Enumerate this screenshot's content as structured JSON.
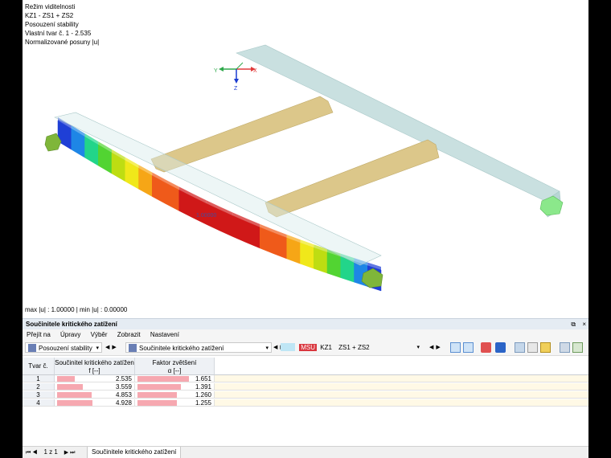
{
  "viewport": {
    "info_lines": [
      "Režim viditelnosti",
      "KZ1 - ZS1 + ZS2",
      "Posouzení stability",
      "Vlastní tvar č. 1 - 2.535",
      "Normalizované posuny |u|"
    ],
    "status": "max |u| : 1.00000 | min |u| : 0.00000",
    "label_value": "1.00000",
    "axes": {
      "x": "X",
      "y": "Y",
      "z": "Z"
    }
  },
  "panel": {
    "title": "Součinitele kritického zatížení",
    "window_buttons": {
      "float": "⧉",
      "close": "×"
    },
    "menu": [
      "Přejít na",
      "Úpravy",
      "Výběr",
      "Zobrazit",
      "Nastavení"
    ],
    "toolbar": {
      "module_combo": "Posouzení stability",
      "table_combo": "Součinitele kritického zatížení",
      "badge": "MSU",
      "combo_id": "KZ1",
      "combo_value": "ZS1 + ZS2"
    },
    "table": {
      "headers": {
        "col0": "Tvar č.",
        "col1_line1": "Součinitel kritického zatížen",
        "col1_line2": "f [--]",
        "col2_line1": "Faktor zvětšení",
        "col2_line2": "α [--]"
      },
      "rows": [
        {
          "num": "1",
          "f": "2.535",
          "f_frac": 0.51,
          "a": "1.651",
          "a_frac": 1.0
        },
        {
          "num": "2",
          "f": "3.559",
          "f_frac": 0.72,
          "a": "1.391",
          "a_frac": 0.84
        },
        {
          "num": "3",
          "f": "4.853",
          "f_frac": 0.98,
          "a": "1.260",
          "a_frac": 0.76
        },
        {
          "num": "4",
          "f": "4.928",
          "f_frac": 1.0,
          "a": "1.255",
          "a_frac": 0.76
        }
      ]
    },
    "bottom": {
      "nav_glyphs": "⏮ ◀",
      "page": "1 z 1",
      "nav_glyphs_right": "▶ ⏭",
      "tab": "Součinitele kritického zatížení"
    }
  },
  "colors": {
    "bar": "#f6a8b0",
    "beam_secondary": "#dcc78a",
    "beam_ghost": "#c9e0e0",
    "deform": [
      "#1f3fd6",
      "#1e86e6",
      "#18c2d8",
      "#22d58a",
      "#52d432",
      "#bedd12",
      "#f0e81a",
      "#f6a616",
      "#ef5a1a",
      "#d01818"
    ]
  }
}
